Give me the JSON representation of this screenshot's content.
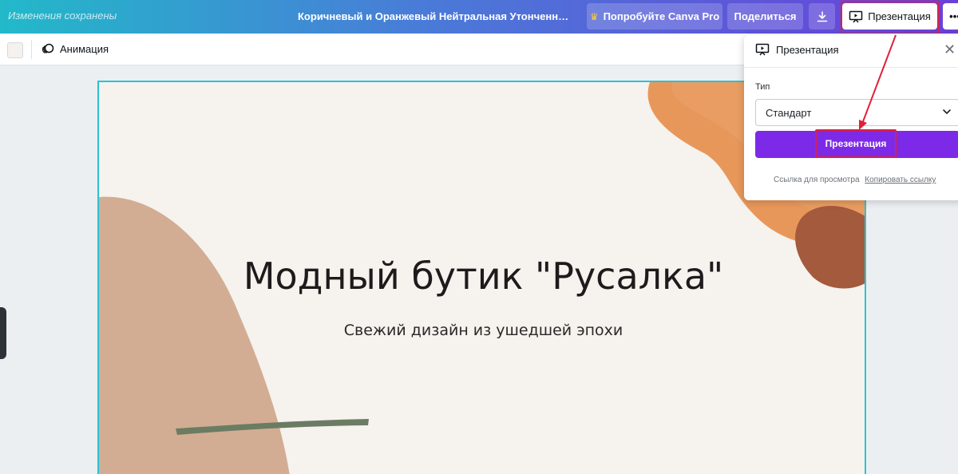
{
  "header": {
    "saved_status": "Изменения сохранены",
    "doc_title": "Коричневый и Оранжевый Нейтральная Утонченная Ор...",
    "try_pro_label": "Попробуйте Canva Pro",
    "share_label": "Поделиться",
    "present_label": "Презентация",
    "more_label": "•••"
  },
  "toolbar": {
    "animation_label": "Анимация"
  },
  "slide": {
    "title": "Модный бутик \"Русалка\"",
    "subtitle": "Свежий дизайн из ушедшей эпохи",
    "colors": {
      "background": "#f6f2ee",
      "beige": "#d2ad93",
      "orange": "#e8975a",
      "rust": "#a45a3c",
      "green": "#6b7c62"
    }
  },
  "present_panel": {
    "title": "Презентация",
    "type_label": "Тип",
    "type_value": "Стандарт",
    "present_button": "Презентация",
    "view_link_label": "Ссылка для просмотра",
    "copy_link_label": "Копировать ссылку"
  },
  "colors": {
    "accent": "#7d2ae8",
    "highlight": "#e0203b",
    "selection": "#28c4d3"
  }
}
